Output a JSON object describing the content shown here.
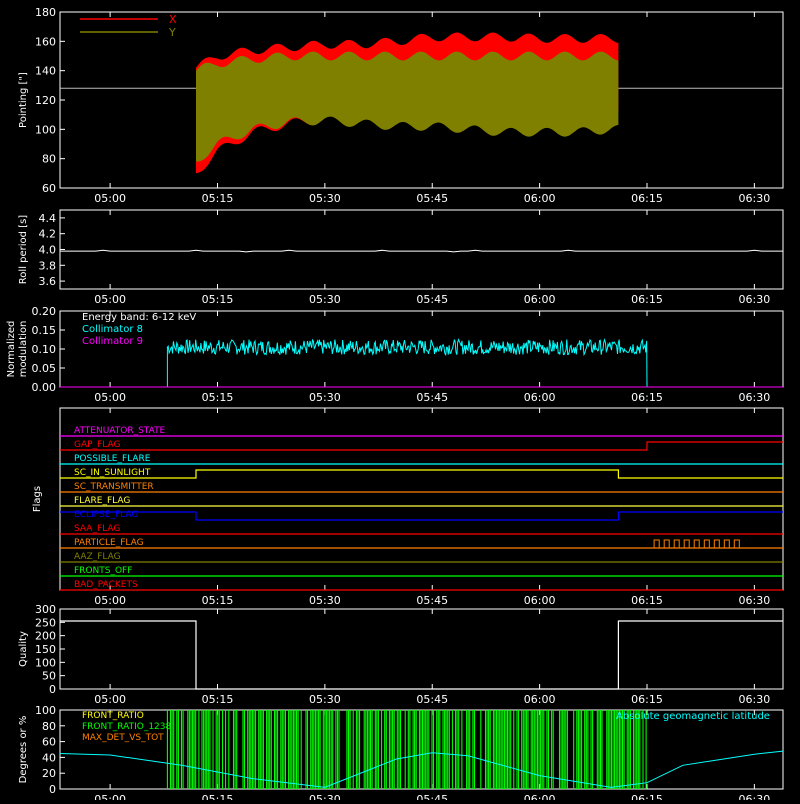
{
  "time_ticks": [
    "05:00",
    "05:15",
    "05:30",
    "05:45",
    "06:00",
    "06:15",
    "06:30"
  ],
  "chart_data": [
    {
      "type": "area",
      "ylabel": "Pointing [\"]",
      "ylim": [
        60,
        180
      ],
      "yticks": [
        60,
        80,
        100,
        120,
        140,
        160,
        180
      ],
      "x_unit_ticks": [
        "05:00",
        "05:15",
        "05:30",
        "05:45",
        "06:00",
        "06:15",
        "06:30"
      ],
      "reference_line": 128,
      "data_start": "05:12",
      "data_end": "06:11",
      "series": [
        {
          "name": "X",
          "color": "#ff0000",
          "time": [
            "05:12",
            "05:15",
            "05:20",
            "05:25",
            "05:30",
            "05:35",
            "05:40",
            "05:45",
            "05:50",
            "05:55",
            "06:00",
            "06:05",
            "06:10"
          ],
          "upper": [
            142,
            150,
            154,
            156,
            158,
            158,
            160,
            163,
            163,
            163,
            162,
            162,
            162
          ],
          "lower": [
            70,
            85,
            98,
            104,
            107,
            108,
            108,
            110,
            110,
            110,
            110,
            110,
            110
          ]
        },
        {
          "name": "Y",
          "color": "#808000",
          "time": [
            "05:12",
            "05:15",
            "05:20",
            "05:25",
            "05:30",
            "05:35",
            "05:40",
            "05:45",
            "05:50",
            "05:55",
            "06:00",
            "06:05",
            "06:10"
          ],
          "upper": [
            140,
            145,
            148,
            150,
            150,
            150,
            150,
            150,
            150,
            150,
            150,
            150,
            150
          ],
          "lower": [
            78,
            90,
            100,
            105,
            106,
            104,
            102,
            102,
            100,
            98,
            98,
            98,
            100
          ]
        }
      ]
    },
    {
      "type": "line",
      "ylabel": "Roll period [s]",
      "ylim": [
        3.5,
        4.5
      ],
      "yticks": [
        "3.6",
        "3.8",
        "4.0",
        "4.2",
        "4.4"
      ],
      "series": [
        {
          "color": "#ffffff",
          "time_range": [
            "04:53",
            "06:34"
          ],
          "value": 3.98
        }
      ]
    },
    {
      "type": "line",
      "ylabel_lines": [
        "Normalized",
        "modulation"
      ],
      "ylim": [
        0,
        0.2
      ],
      "yticks": [
        "0.00",
        "0.05",
        "0.10",
        "0.15",
        "0.20"
      ],
      "annotation": "Energy band: 6-12 keV",
      "series": [
        {
          "name": "Collimator 8",
          "color": "#00ffff",
          "time_range": [
            "05:08",
            "06:15"
          ],
          "mean": 0.105,
          "spread": 0.02
        },
        {
          "name": "Collimator 9",
          "color": "#ff00ff",
          "time_range": [
            "04:53",
            "06:34"
          ],
          "mean": 0.0,
          "spread": 0
        }
      ]
    },
    {
      "type": "line",
      "ylabel": "Flags",
      "series": [
        {
          "name": "ATTENUATOR_STATE",
          "color": "#ff00ff",
          "segments": [
            [
              "04:53",
              "06:34",
              0
            ]
          ]
        },
        {
          "name": "GAP_FLAG",
          "color": "#ff0000",
          "segments": [
            [
              "04:53",
              "06:15",
              0
            ],
            [
              "06:15",
              "06:34",
              1
            ]
          ]
        },
        {
          "name": "POSSIBLE_FLARE",
          "color": "#00ffff",
          "segments": [
            [
              "04:53",
              "06:34",
              0
            ]
          ]
        },
        {
          "name": "SC_IN_SUNLIGHT",
          "color": "#ffff00",
          "segments": [
            [
              "04:53",
              "05:12",
              0
            ],
            [
              "05:12",
              "06:11",
              1
            ],
            [
              "06:11",
              "06:34",
              0
            ]
          ]
        },
        {
          "name": "SC_TRANSMITTER",
          "color": "#ff8000",
          "segments": [
            [
              "04:53",
              "06:34",
              0
            ]
          ]
        },
        {
          "name": "FLARE_FLAG",
          "color": "#ffff40",
          "segments": [
            [
              "04:53",
              "06:34",
              0
            ]
          ]
        },
        {
          "name": "ECLIPSE_FLAG",
          "color": "#0000ff",
          "segments": [
            [
              "04:53",
              "05:12",
              1
            ],
            [
              "05:12",
              "06:11",
              0
            ],
            [
              "06:11",
              "06:34",
              1
            ]
          ]
        },
        {
          "name": "SAA_FLAG",
          "color": "#ff0000",
          "segments": [
            [
              "04:53",
              "06:34",
              0
            ]
          ]
        },
        {
          "name": "PARTICLE_FLAG",
          "color": "#ff8000",
          "segments": [
            [
              "04:53",
              "06:34",
              0
            ]
          ]
        },
        {
          "name": "AAZ_FLAG",
          "color": "#808000",
          "segments": [
            [
              "04:53",
              "06:34",
              0
            ]
          ]
        },
        {
          "name": "FRONTS_OFF",
          "color": "#00ff00",
          "segments": [
            [
              "04:53",
              "06:34",
              0
            ]
          ]
        },
        {
          "name": "BAD_PACKETS",
          "color": "#ff0000",
          "segments": [
            [
              "04:53",
              "06:34",
              0
            ]
          ]
        }
      ]
    },
    {
      "type": "line",
      "ylabel": "Quality",
      "ylim": [
        0,
        300
      ],
      "yticks": [
        "0",
        "50",
        "100",
        "150",
        "200",
        "250",
        "300"
      ],
      "series": [
        {
          "color": "#ffffff",
          "segments": [
            [
              "04:53",
              "05:12",
              255
            ],
            [
              "05:12",
              "06:11",
              0
            ],
            [
              "06:11",
              "06:34",
              255
            ]
          ]
        }
      ]
    },
    {
      "type": "area",
      "ylabel": "Degrees or %",
      "ylim": [
        0,
        100
      ],
      "yticks": [
        "0",
        "20",
        "40",
        "60",
        "80",
        "100"
      ],
      "series": [
        {
          "name": "FRONT_RATIO",
          "color": "#ffff00"
        },
        {
          "name": "FRONT_RATIO_1238",
          "color": "#00ff00",
          "time_range": [
            "05:08",
            "06:15"
          ]
        },
        {
          "name": "MAX_DET_VS_TOT",
          "color": "#ff8000"
        },
        {
          "name": "Absolute geomagnetic latitude",
          "color": "#00ffff",
          "time": [
            "04:53",
            "05:00",
            "05:10",
            "05:20",
            "05:30",
            "05:40",
            "05:45",
            "05:50",
            "06:00",
            "06:10",
            "06:15",
            "06:20",
            "06:30",
            "06:34"
          ],
          "values": [
            45,
            43,
            30,
            13,
            2,
            38,
            46,
            42,
            17,
            2,
            8,
            30,
            44,
            48
          ]
        }
      ]
    }
  ]
}
